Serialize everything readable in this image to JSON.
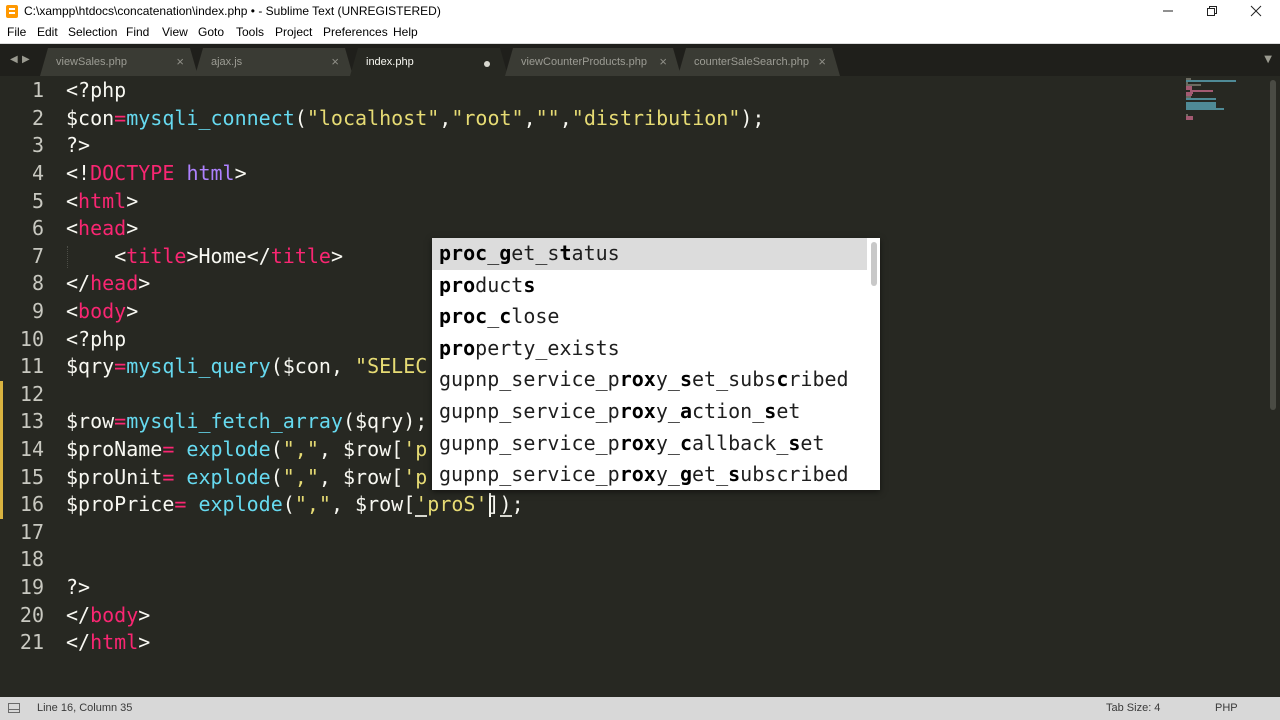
{
  "window": {
    "title": "C:\\xampp\\htdocs\\concatenation\\index.php • - Sublime Text (UNREGISTERED)",
    "controls": [
      "minimize-icon",
      "restore-icon",
      "close-icon"
    ]
  },
  "menu": {
    "items": [
      "File",
      "Edit",
      "Selection",
      "Find",
      "View",
      "Goto",
      "Tools",
      "Project",
      "Preferences",
      "Help"
    ]
  },
  "tabs": [
    {
      "label": "viewSales.php",
      "active": false,
      "modified": false
    },
    {
      "label": "ajax.js",
      "active": false,
      "modified": false
    },
    {
      "label": "index.php",
      "active": true,
      "modified": true
    },
    {
      "label": "viewCounterProducts.php",
      "active": false,
      "modified": false
    },
    {
      "label": "counterSaleSearch.php",
      "active": false,
      "modified": false
    }
  ],
  "editor": {
    "line_numbers": [
      "1",
      "2",
      "3",
      "4",
      "5",
      "6",
      "7",
      "8",
      "9",
      "10",
      "11",
      "12",
      "13",
      "14",
      "15",
      "16",
      "17",
      "18",
      "19",
      "20",
      "21"
    ],
    "modified_lines": [
      "12",
      "13",
      "14",
      "15",
      "16"
    ],
    "lines": [
      "<?php",
      "$con=mysqli_connect(\"localhost\",\"root\",\"\",\"distribution\");",
      "?>",
      "<!DOCTYPE html>",
      "<html>",
      "<head>",
      "    <title>Home</title>",
      "</head>",
      "<body>",
      "<?php",
      "$qry=mysqli_query($con, \"SELEC",
      "",
      "$row=mysqli_fetch_array($qry);",
      "$proName= explode(\",\", $row['p",
      "$proUnit= explode(\",\", $row['p",
      "$proPrice= explode(\",\", $row['proS']);",
      "",
      "",
      "?>",
      "</body>",
      "</html>"
    ],
    "cursor": {
      "line": 16,
      "column": 35
    }
  },
  "autocomplete": {
    "selected_index": 0,
    "items": [
      {
        "text": "proc_get_status"
      },
      {
        "text": "products"
      },
      {
        "text": "proc_close"
      },
      {
        "text": "property_exists"
      },
      {
        "text": "gupnp_service_proxy_set_subscribed"
      },
      {
        "text": "gupnp_service_proxy_action_set"
      },
      {
        "text": "gupnp_service_proxy_callback_set"
      },
      {
        "text": "gupnp_service_proxy_get_subscribed"
      }
    ]
  },
  "status": {
    "position": "Line 16, Column 35",
    "tab_size": "Tab Size: 4",
    "syntax": "PHP"
  },
  "colors": {
    "background": "#272822",
    "keyword": "#f92672",
    "function": "#66d9ef",
    "string": "#e6db74",
    "text": "#f8f8f2",
    "modified_marker": "#d9b340"
  }
}
